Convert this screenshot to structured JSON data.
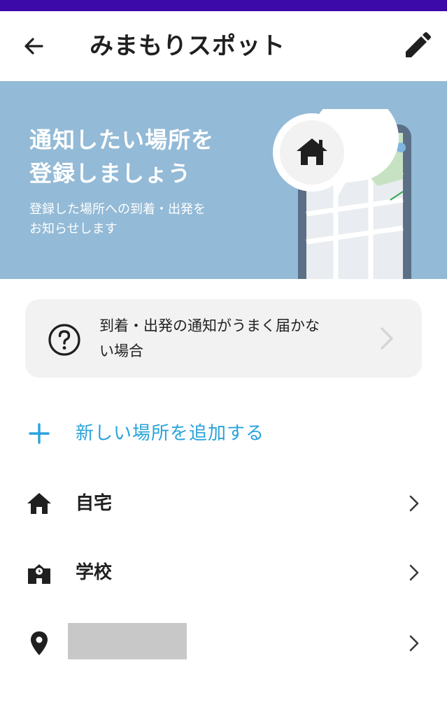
{
  "app_bar": {
    "title": "みまもりスポット",
    "back_icon": "arrow-left-icon",
    "edit_icon": "pencil-icon"
  },
  "banner": {
    "headline_line1": "通知したい場所を",
    "headline_line2": "登録しましょう",
    "sub_line1": "登録した場所への到着・出発を",
    "sub_line2": "お知らせします"
  },
  "help": {
    "line1": "到着・出発の通知がうまく届かな",
    "line2": "い場合"
  },
  "add_spot": {
    "label": "新しい場所を追加する"
  },
  "spots": [
    {
      "label": "自宅",
      "icon": "home-icon"
    },
    {
      "label": "学校",
      "icon": "school-icon"
    },
    {
      "label": "",
      "icon": "location-pin-icon"
    }
  ],
  "colors": {
    "status_bar": "#3b0aa8",
    "banner_bg": "#93bad6",
    "accent": "#29a3db",
    "card_bg": "#f2f2f2",
    "redacted": "#c8c8c8"
  }
}
